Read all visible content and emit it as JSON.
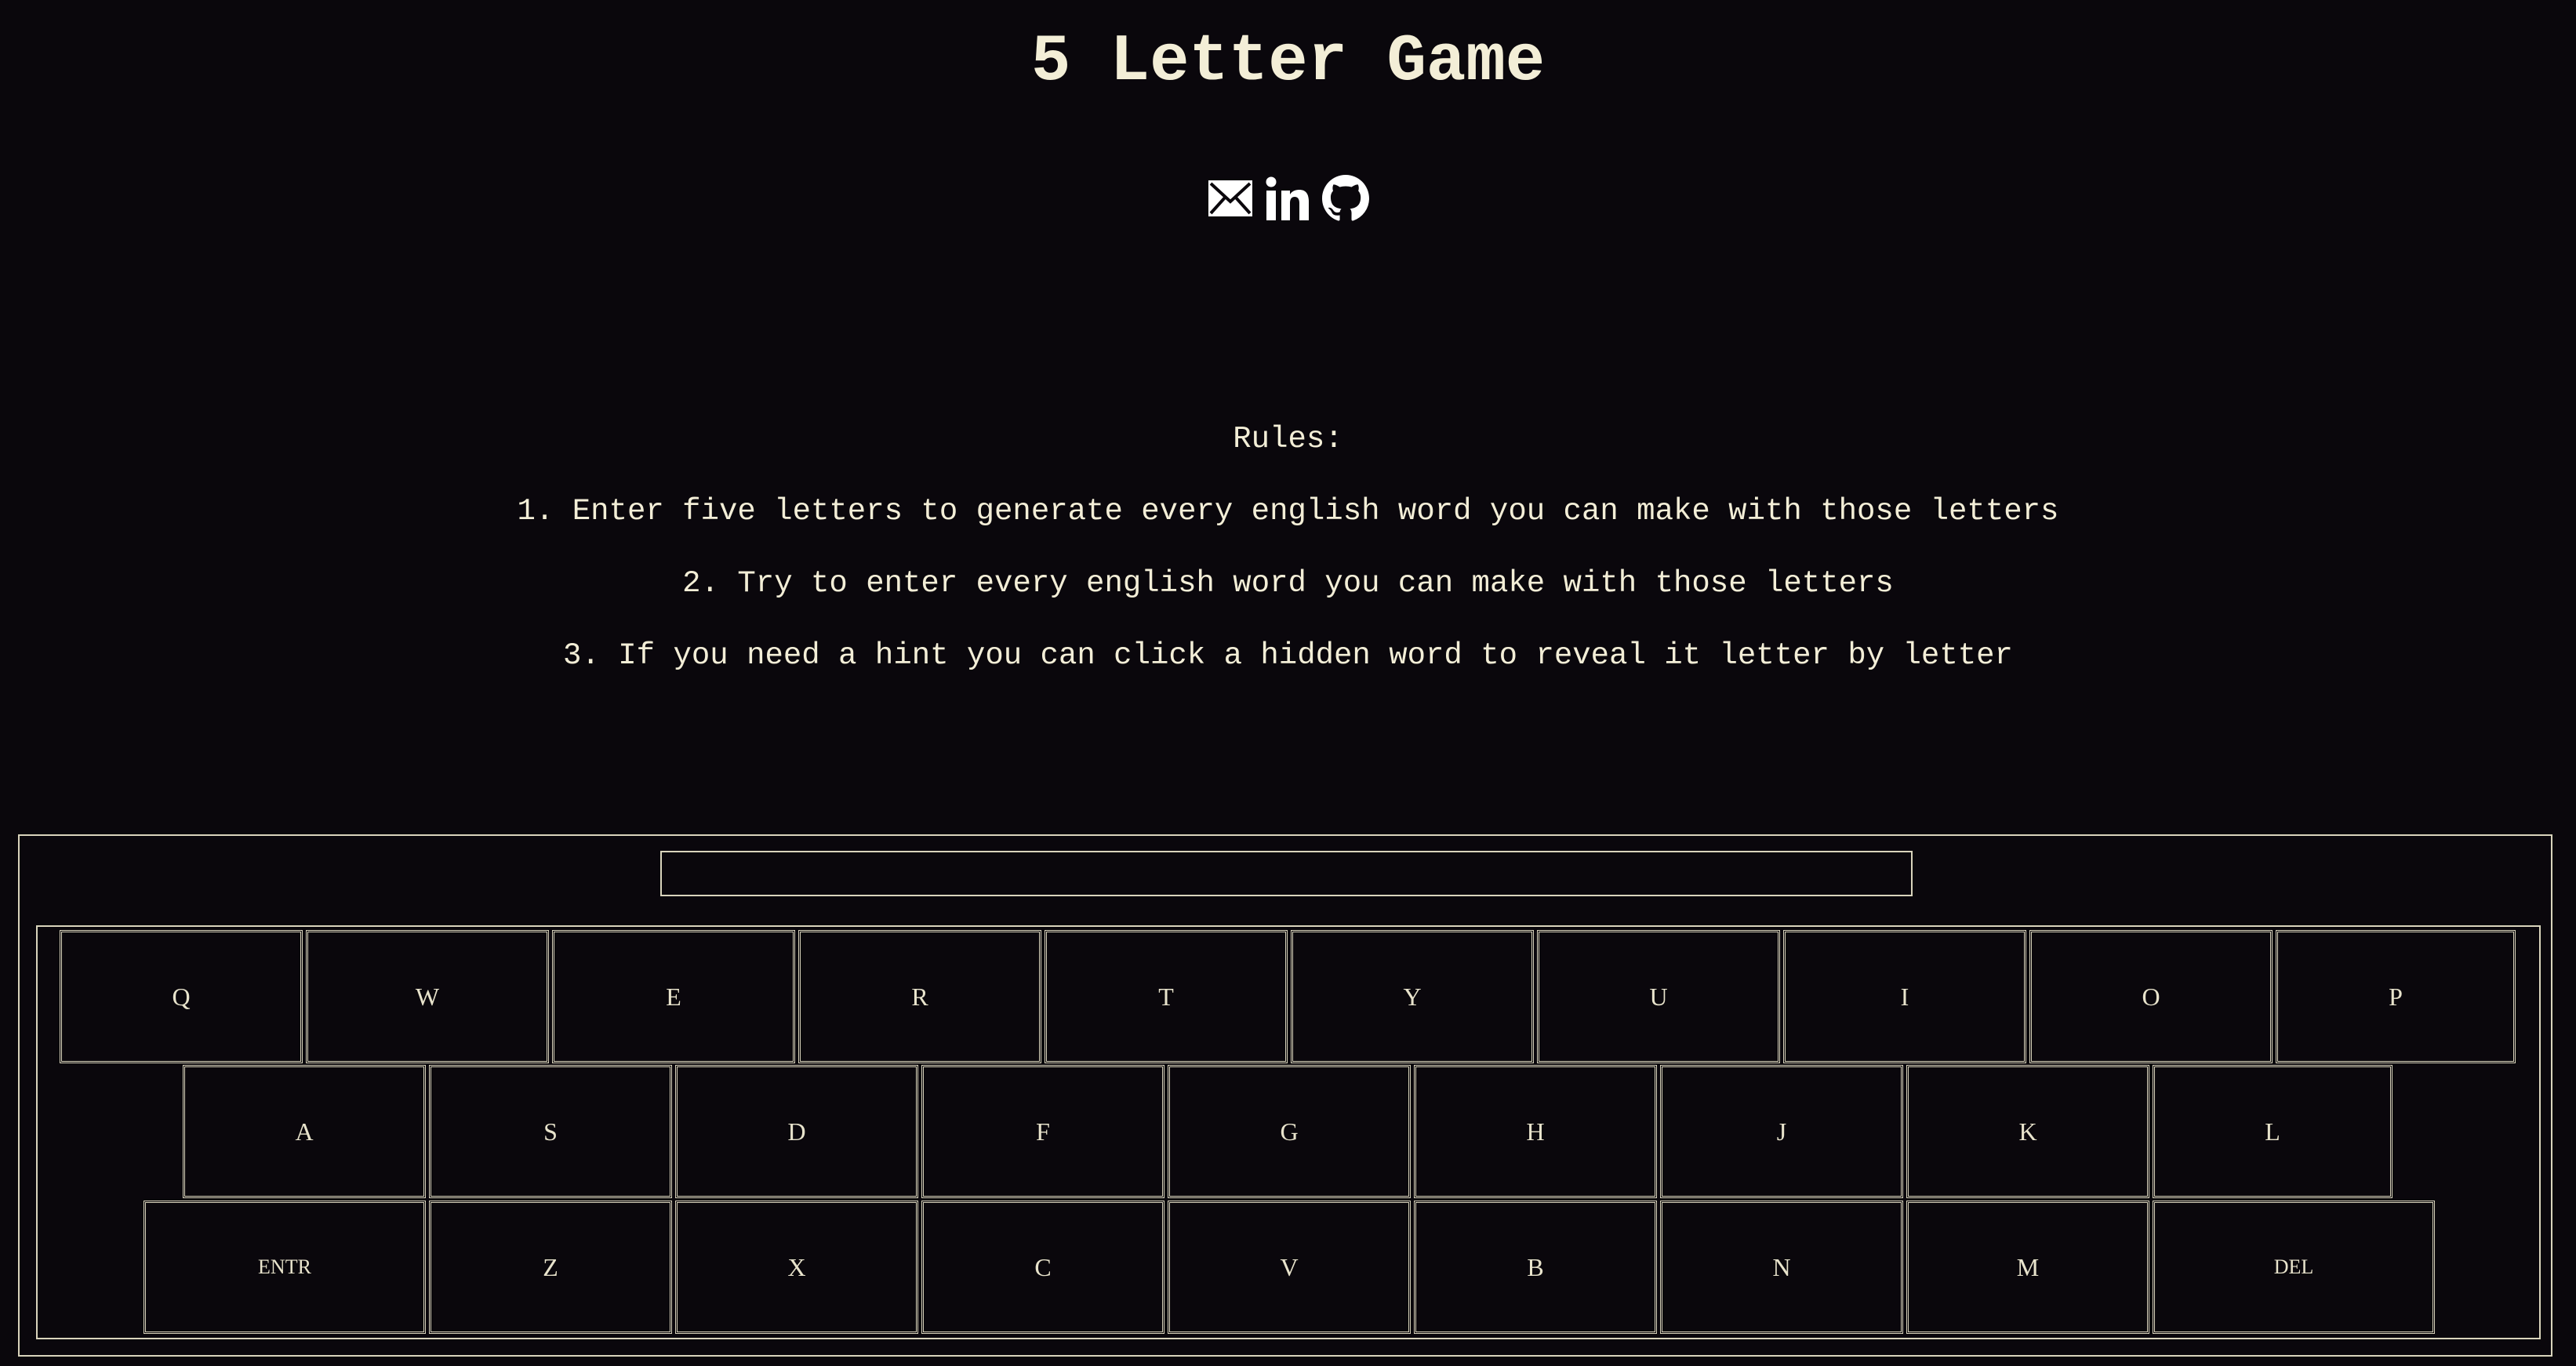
{
  "title": "5 Letter Game",
  "social": [
    {
      "name": "email",
      "icon": "envelope-icon"
    },
    {
      "name": "linkedin",
      "icon": "linkedin-icon"
    },
    {
      "name": "github",
      "icon": "github-icon"
    }
  ],
  "rules": {
    "heading": "Rules:",
    "items": [
      "1. Enter five letters to generate every english word you can make with those letters",
      "2. Try to enter every english word you can make with those letters",
      "3. If you need a hint you can click a hidden word to reveal it letter by letter"
    ]
  },
  "entry": {
    "value": ""
  },
  "keyboard": {
    "row1": [
      "Q",
      "W",
      "E",
      "R",
      "T",
      "Y",
      "U",
      "I",
      "O",
      "P"
    ],
    "row2": [
      "A",
      "S",
      "D",
      "F",
      "G",
      "H",
      "J",
      "K",
      "L"
    ],
    "row3": [
      "ENTR",
      "Z",
      "X",
      "C",
      "V",
      "B",
      "N",
      "M",
      "DEL"
    ]
  },
  "colors": {
    "background": "#0a070c",
    "text": "#f3eed7",
    "border": "#d9d4bc"
  }
}
